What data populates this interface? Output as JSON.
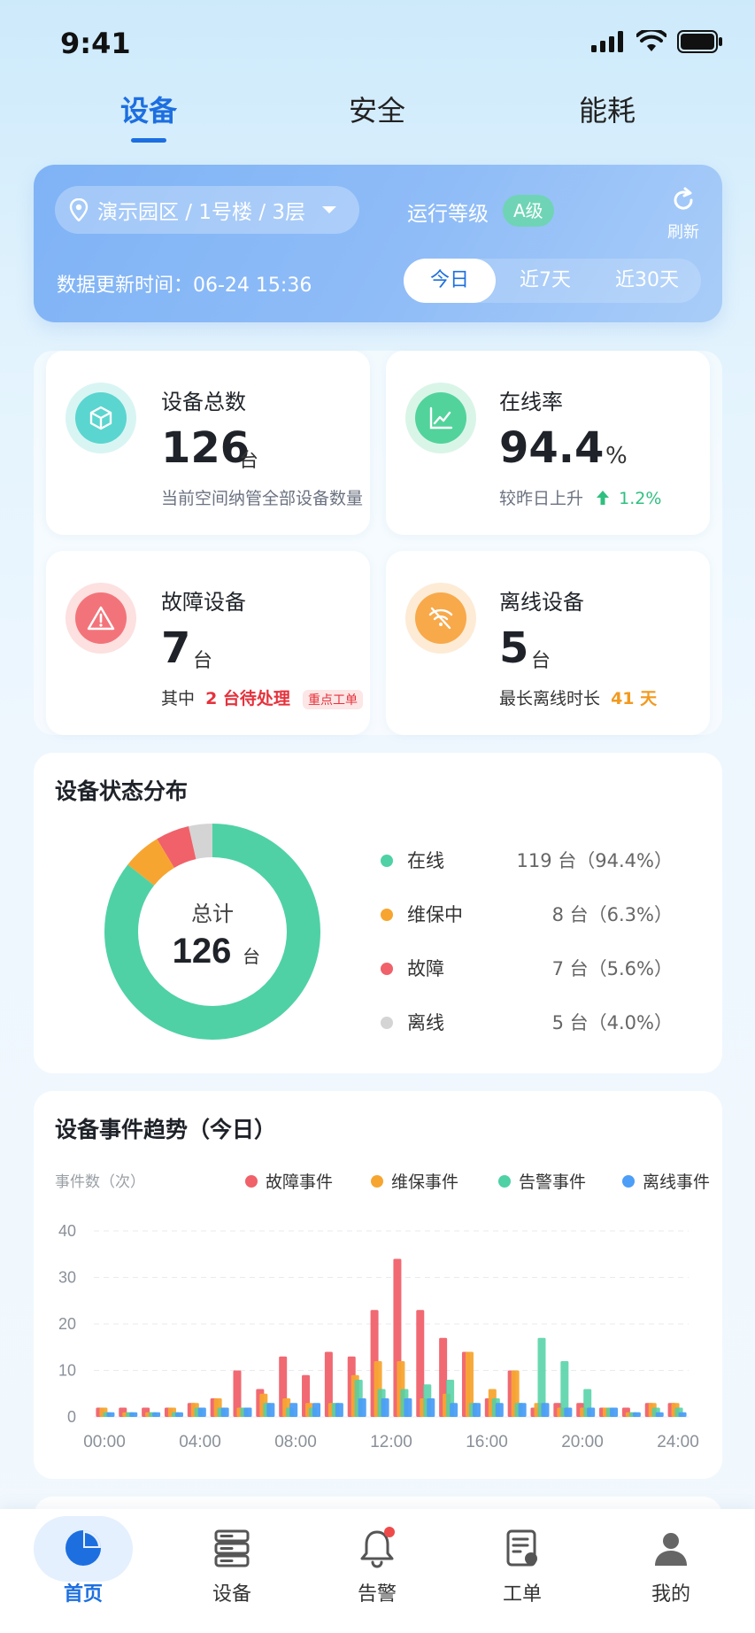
{
  "status_bar": {
    "time": "9:41"
  },
  "top_tabs": [
    {
      "label": "设备",
      "active": true
    },
    {
      "label": "安全",
      "active": false
    },
    {
      "label": "能耗",
      "active": false
    }
  ],
  "header": {
    "location": "演示园区 / 1号楼 / 3层",
    "level_label": "运行等级",
    "level_badge": "A级",
    "refresh_label": "刷新",
    "update_text": "数据更新时间：06-24 15:36",
    "ranges": [
      "今日",
      "近7天",
      "近30天"
    ],
    "active_range": "今日"
  },
  "stats": {
    "total": {
      "title": "设备总数",
      "value": "126",
      "unit": "台",
      "note": "当前空间纳管全部设备数量"
    },
    "online_rate": {
      "title": "在线率",
      "value": "94.4",
      "unit": "%",
      "note": "较昨日上升",
      "change": "1.2%"
    },
    "fault": {
      "title": "故障设备",
      "value": "7",
      "unit": "台",
      "note_prefix": "其中",
      "pending": "2 台待处理",
      "tag": "重点工单"
    },
    "offline": {
      "title": "离线设备",
      "value": "5",
      "unit": "台",
      "note_prefix": "最长离线时长",
      "duration": "41 天"
    }
  },
  "status_distribution": {
    "title": "设备状态分布",
    "center_label": "总计",
    "center_value": "126",
    "center_unit": "台",
    "items": [
      {
        "name": "在线",
        "value": "119 台（94.4%）",
        "count": 119,
        "color": "#4fd1a5"
      },
      {
        "name": "维保中",
        "value": "8 台（6.3%）",
        "count": 8,
        "color": "#f7a531"
      },
      {
        "name": "故障",
        "value": "7 台（5.6%）",
        "count": 7,
        "color": "#f0616a"
      },
      {
        "name": "离线",
        "value": "5 台（4.0%）",
        "count": 5,
        "color": "#d4d4d4"
      }
    ]
  },
  "chart_data": {
    "type": "bar",
    "title": "设备事件趋势（今日）",
    "ylabel": "事件数（次）",
    "ylim": [
      0,
      40
    ],
    "yticks": [
      "0",
      "10",
      "20",
      "30",
      "40"
    ],
    "xticks": [
      "00:00",
      "04:00",
      "08:00",
      "12:00",
      "16:00",
      "20:00",
      "24:00"
    ],
    "legend_position": "top",
    "grid": true,
    "series": [
      {
        "name": "故障事件",
        "color": "#f0616a",
        "values": [
          2,
          2,
          2,
          2,
          3,
          4,
          10,
          6,
          13,
          9,
          14,
          13,
          23,
          34,
          23,
          17,
          14,
          4,
          10,
          2,
          3,
          3,
          2,
          2,
          3,
          3
        ]
      },
      {
        "name": "维保事件",
        "color": "#f7a531",
        "values": [
          2,
          1,
          1,
          2,
          3,
          4,
          2,
          5,
          4,
          3,
          3,
          9,
          12,
          12,
          4,
          5,
          14,
          6,
          10,
          3,
          2,
          2,
          2,
          1,
          3,
          3
        ]
      },
      {
        "name": "告警事件",
        "color": "#4fd1a5",
        "values": [
          1,
          1,
          1,
          1,
          2,
          2,
          2,
          3,
          2,
          2,
          3,
          8,
          6,
          6,
          7,
          8,
          3,
          4,
          3,
          17,
          12,
          6,
          2,
          1,
          2,
          2
        ]
      },
      {
        "name": "离线事件",
        "color": "#4c9ef7",
        "values": [
          1,
          1,
          1,
          1,
          2,
          2,
          2,
          3,
          3,
          3,
          3,
          4,
          4,
          4,
          4,
          3,
          3,
          3,
          3,
          3,
          2,
          2,
          2,
          1,
          1,
          1
        ]
      }
    ]
  },
  "bottom_nav": [
    {
      "label": "首页",
      "icon": "home-pie-icon",
      "active": true
    },
    {
      "label": "设备",
      "icon": "server-icon",
      "active": false
    },
    {
      "label": "告警",
      "icon": "bell-icon",
      "active": false
    },
    {
      "label": "工单",
      "icon": "clipboard-icon",
      "active": false
    },
    {
      "label": "我的",
      "icon": "user-icon",
      "active": false
    }
  ]
}
